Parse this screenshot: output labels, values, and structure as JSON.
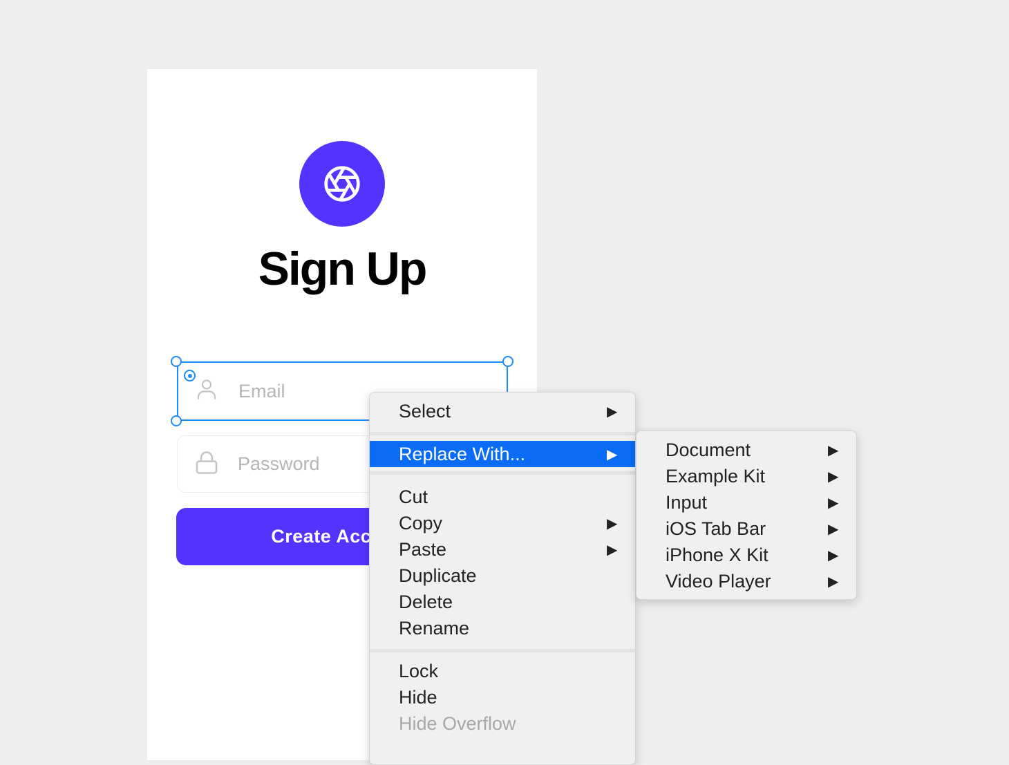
{
  "signup": {
    "title": "Sign Up",
    "email_placeholder": "Email",
    "password_placeholder": "Password",
    "create_button": "Create Account",
    "brand_color": "#5533ff",
    "logo_icon": "aperture-icon"
  },
  "context_menu": {
    "items": [
      {
        "label": "Select",
        "submenu": true
      },
      {
        "label": "Replace With...",
        "submenu": true,
        "highlighted": true
      },
      {
        "label": "Cut"
      },
      {
        "label": "Copy",
        "submenu": true
      },
      {
        "label": "Paste",
        "submenu": true
      },
      {
        "label": "Duplicate"
      },
      {
        "label": "Delete"
      },
      {
        "label": "Rename"
      },
      {
        "label": "Lock"
      },
      {
        "label": "Hide"
      },
      {
        "label": "Hide Overflow",
        "disabled": true
      }
    ],
    "arrow": "▶",
    "highlight_color": "#0a6cf5"
  },
  "replace_submenu": {
    "items": [
      {
        "label": "Document"
      },
      {
        "label": "Example Kit"
      },
      {
        "label": "Input"
      },
      {
        "label": "iOS Tab Bar"
      },
      {
        "label": "iPhone X Kit"
      },
      {
        "label": "Video Player"
      }
    ]
  },
  "selection_color": "#1a8cff"
}
